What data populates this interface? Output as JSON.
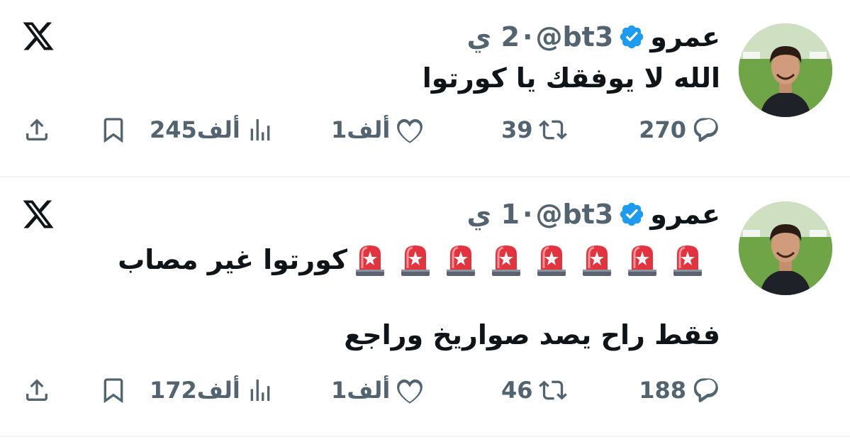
{
  "tweets": [
    {
      "name": "عمرو",
      "handle": "@bt3",
      "sep": "·",
      "time": "2 ي",
      "text": "الله لا يوفقك يا كورتوا",
      "replies": "270",
      "retweets": "39",
      "likes": "1ألف",
      "views": "245ألف"
    },
    {
      "name": "عمرو",
      "handle": "@bt3",
      "sep": "·",
      "time": "1 ي",
      "text_line1": "كورتوا غير مصاب",
      "text_line2": "فقط راح يصد صواريخ وراجع",
      "siren_count": 8,
      "replies": "188",
      "retweets": "46",
      "likes": "1ألف",
      "views": "172ألف"
    }
  ],
  "colors": {
    "verified": "#1d9bf0",
    "muted": "#536471",
    "text": "#0f1419",
    "divider": "#eff3f4"
  },
  "icons": [
    "x-logo-icon",
    "verified-badge-icon",
    "reply-icon",
    "retweet-icon",
    "like-icon",
    "views-icon",
    "bookmark-icon",
    "share-icon",
    "siren-emoji"
  ]
}
